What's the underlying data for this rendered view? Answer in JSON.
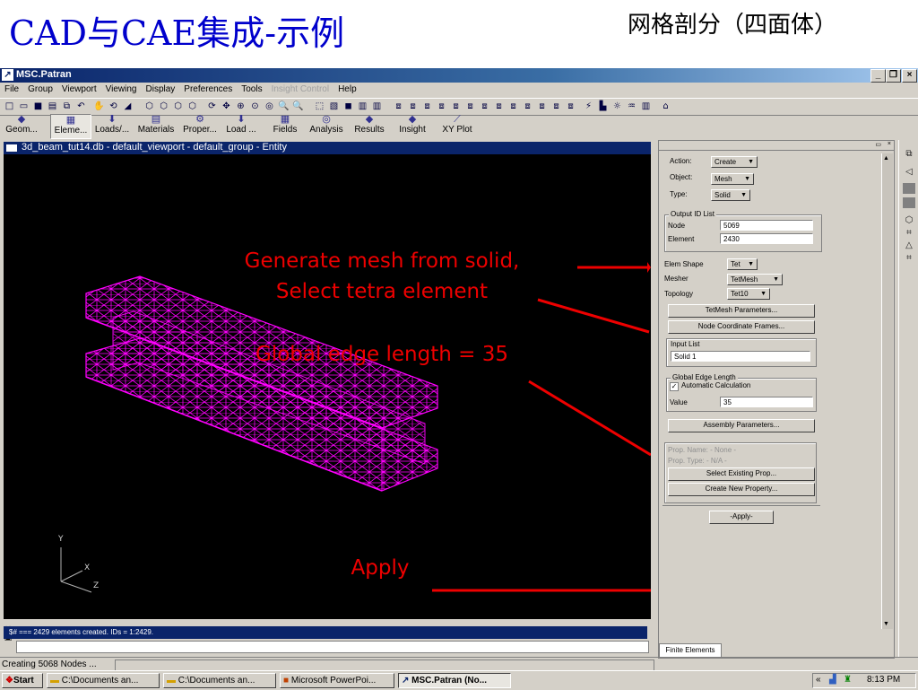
{
  "slide": {
    "title": "CAD与CAE集成-示例",
    "subtitle": "网格剖分（四面体）"
  },
  "window": {
    "title": "MSC.Patran",
    "buttons": [
      "_",
      "❐",
      "×"
    ]
  },
  "menu": [
    "File",
    "Group",
    "Viewport",
    "Viewing",
    "Display",
    "Preferences",
    "Tools",
    "Insight Control",
    "Help"
  ],
  "apps": [
    {
      "label": "Geom...",
      "icon": "◆"
    },
    {
      "label": "Eleme...",
      "icon": "▦"
    },
    {
      "label": "Loads/...",
      "icon": "⬇"
    },
    {
      "label": "Materials",
      "icon": "▤"
    },
    {
      "label": "Proper...",
      "icon": "⚙"
    },
    {
      "label": "Load ...",
      "icon": "⬇"
    },
    {
      "label": "Fields",
      "icon": "▦"
    },
    {
      "label": "Analysis",
      "icon": "◎"
    },
    {
      "label": "Results",
      "icon": "◆"
    },
    {
      "label": "Insight",
      "icon": "◆"
    },
    {
      "label": "XY Plot",
      "icon": "⟋"
    }
  ],
  "viewport": {
    "title": "3d_beam_tut14.db - default_viewport - default_group - Entity",
    "axes": {
      "y": "Y",
      "x": "X",
      "z": "Z"
    }
  },
  "annotations": {
    "mesh_line1": "Generate mesh from solid,",
    "mesh_line2": "Select tetra element",
    "edge": "Global edge length = 35",
    "apply": "Apply",
    "color": "#ee0000"
  },
  "panel": {
    "action_label": "Action:",
    "action_value": "Create",
    "object_label": "Object:",
    "object_value": "Mesh",
    "type_label": "Type:",
    "type_value": "Solid",
    "output_group": "Output ID List",
    "node_label": "Node",
    "node_value": "5069",
    "element_label": "Element",
    "element_value": "2430",
    "elem_shape_label": "Elem Shape",
    "elem_shape_value": "Tet",
    "mesher_label": "Mesher",
    "mesher_value": "TetMesh",
    "topology_label": "Topology",
    "topology_value": "Tet10",
    "tetmesh_params": "TetMesh Parameters...",
    "node_coord": "Node Coordinate Frames...",
    "input_group": "Input List",
    "input_value": "Solid 1",
    "edge_group": "Global Edge Length",
    "auto_calc": "Automatic Calculation",
    "value_label": "Value",
    "value_value": "35",
    "assembly": "Assembly Parameters...",
    "prop_name": "Prop. Name:   - None -",
    "prop_type": "Prop. Type:   - N/A -",
    "select_prop": "Select Existing Prop...",
    "create_prop": "Create New Property...",
    "apply_btn": "-Apply-",
    "tab": "Finite Elements"
  },
  "command_line": "$# === 2429 elements created.  IDs = 1:2429.",
  "status": "Creating 5068 Nodes ...",
  "taskbar": {
    "start": "Start",
    "items": [
      "C:\\Documents an...",
      "C:\\Documents an...",
      "Microsoft PowerPoi...",
      "MSC.Patran (No..."
    ],
    "time": "8:13 PM"
  },
  "colors": {
    "mesh": "#ff00ff",
    "titlebar": "#0a246a",
    "slide_title": "#0000cc"
  }
}
